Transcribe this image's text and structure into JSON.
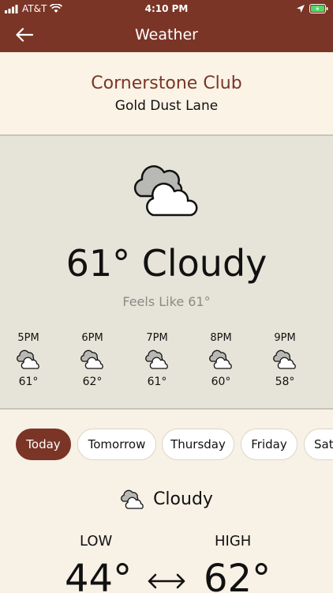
{
  "status_bar": {
    "carrier": "AT&T",
    "time": "4:10 PM"
  },
  "nav": {
    "title": "Weather",
    "back_icon": "arrow-left-icon"
  },
  "location": {
    "name": "Cornerstone Club",
    "subtitle": "Gold Dust Lane"
  },
  "current": {
    "icon": "cloudy-icon",
    "headline": "61° Cloudy",
    "feels_like": "Feels Like 61°"
  },
  "hourly": [
    {
      "time": "5PM",
      "temp": "61°",
      "icon": "cloudy-icon"
    },
    {
      "time": "6PM",
      "temp": "62°",
      "icon": "cloudy-icon"
    },
    {
      "time": "7PM",
      "temp": "61°",
      "icon": "cloudy-icon"
    },
    {
      "time": "8PM",
      "temp": "60°",
      "icon": "cloudy-icon"
    },
    {
      "time": "9PM",
      "temp": "58°",
      "icon": "cloudy-icon"
    }
  ],
  "day_tabs": [
    {
      "label": "Today",
      "active": true
    },
    {
      "label": "Tomorrow",
      "active": false
    },
    {
      "label": "Thursday",
      "active": false
    },
    {
      "label": "Friday",
      "active": false
    },
    {
      "label": "Sat",
      "active": false
    }
  ],
  "day_forecast": {
    "condition": "Cloudy",
    "icon": "cloudy-icon",
    "low_label": "LOW",
    "high_label": "HIGH",
    "low": "44°",
    "high": "62°",
    "range_icon": "double-arrow-icon"
  },
  "colors": {
    "brand": "#7a3526",
    "panel": "#e6e4d8",
    "background": "#f7f1e6"
  }
}
